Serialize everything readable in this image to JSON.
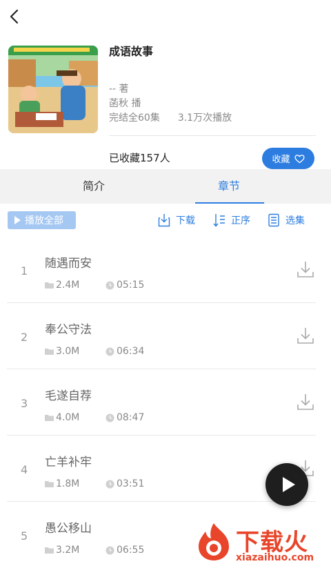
{
  "book": {
    "title": "成语故事",
    "author": "-- 著",
    "narrator": "菡秋 播",
    "status": "完结全60集",
    "plays": "3.1万次播放",
    "favorites": "已收藏157人",
    "favorite_button": "收藏"
  },
  "tabs": [
    {
      "label": "简介",
      "active": false
    },
    {
      "label": "章节",
      "active": true
    }
  ],
  "toolbar": {
    "play_all": "播放全部",
    "download": "下载",
    "order": "正序",
    "select": "选集"
  },
  "chapters": [
    {
      "num": "1",
      "name": "随遇而安",
      "size": "2.4M",
      "duration": "05:15"
    },
    {
      "num": "2",
      "name": "奉公守法",
      "size": "3.0M",
      "duration": "06:34"
    },
    {
      "num": "3",
      "name": "毛遂自荐",
      "size": "4.0M",
      "duration": "08:47"
    },
    {
      "num": "4",
      "name": "亡羊补牢",
      "size": "1.8M",
      "duration": "03:51"
    },
    {
      "num": "5",
      "name": "愚公移山",
      "size": "3.2M",
      "duration": "06:55"
    }
  ],
  "watermark": {
    "text": "下载火",
    "url": "xiazaihuo.com"
  },
  "colors": {
    "accent": "#2d7de0",
    "play_all_bg": "#a5c8f3",
    "watermark": "#e8452a"
  }
}
